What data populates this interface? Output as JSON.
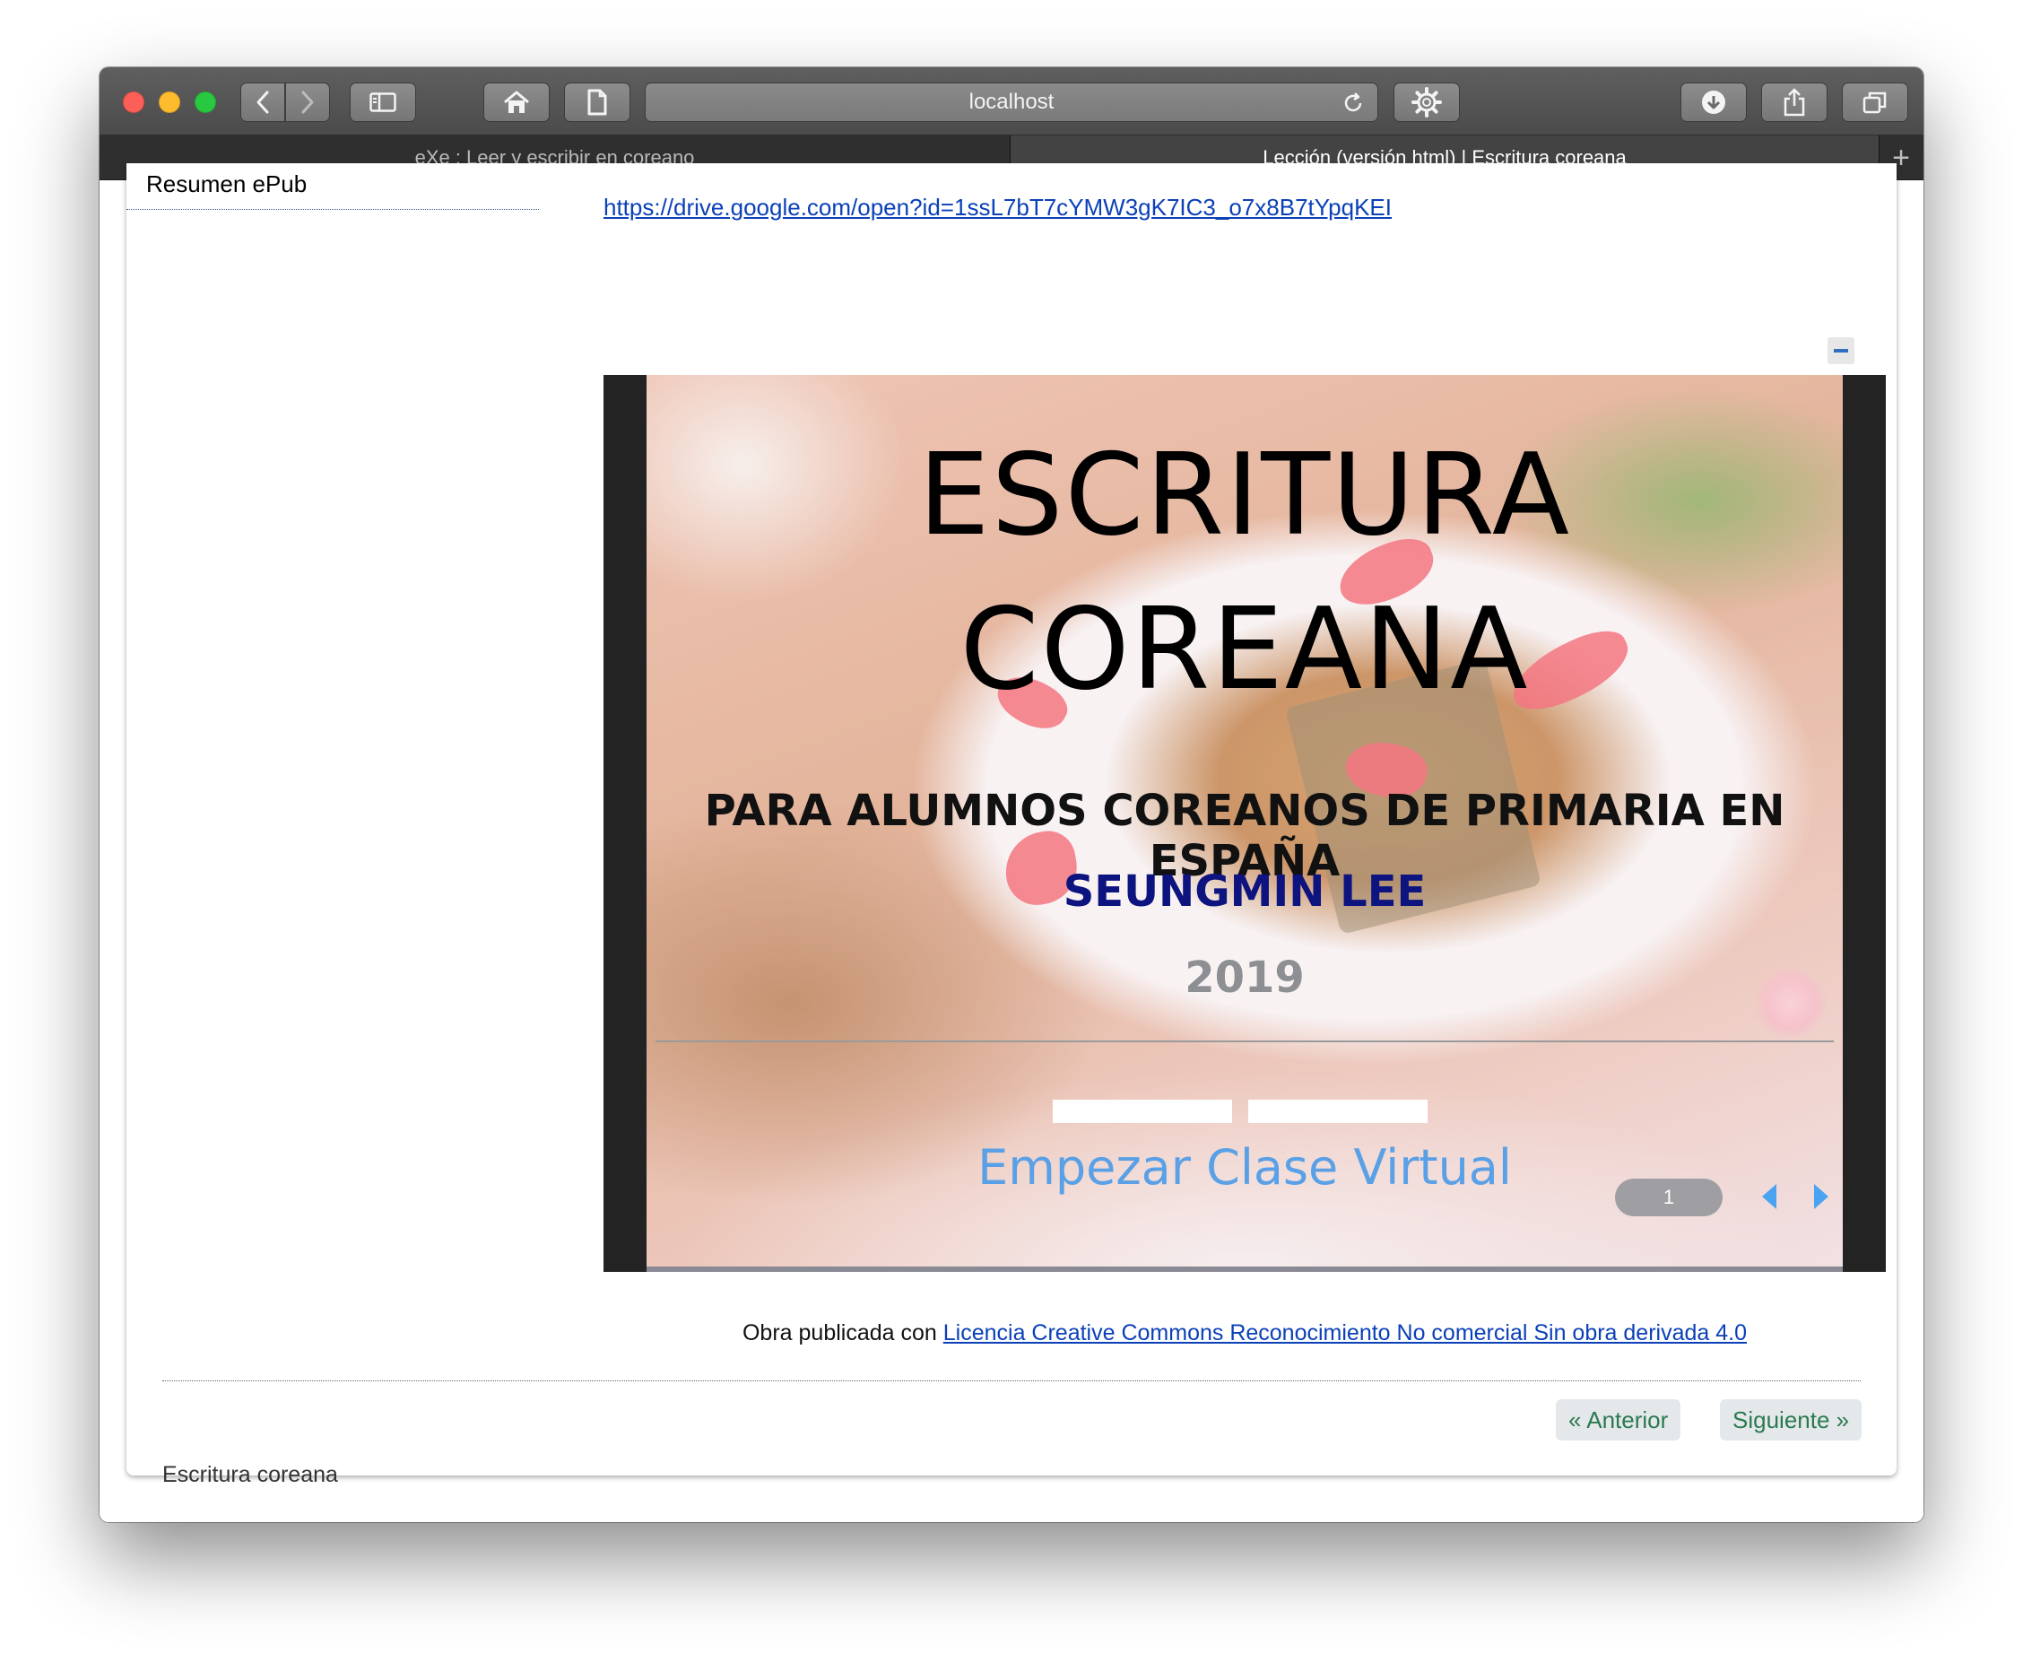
{
  "browser": {
    "address": "localhost",
    "tabs": [
      {
        "label": "eXe : Leer y escribir en coreano",
        "active": false
      },
      {
        "label": "Lección (versión html) | Escritura coreana",
        "active": true
      }
    ],
    "new_tab": "+"
  },
  "sidebar": {
    "items": [
      {
        "label": "Resumen ePub"
      }
    ]
  },
  "content": {
    "drive_link": "https://drive.google.com/open?id=1ssL7bT7cYMW3gK7IC3_o7x8B7tYpqKEI",
    "slide": {
      "title_line1": "ESCRITURA",
      "title_line2": "COREANA",
      "subtitle": "PARA ALUMNOS COREANOS DE PRIMARIA EN ESPAÑA",
      "author": "SEUNGMIN LEE",
      "year": "2019",
      "start_label": "Empezar Clase Virtual",
      "page_number": "1"
    },
    "license_prefix": "Obra publicada con",
    "license_link": "Licencia Creative Commons Reconocimiento No comercial Sin obra derivada 4.0"
  },
  "nav": {
    "prev": "« Anterior",
    "next": "Siguiente »"
  },
  "footer": {
    "title": "Escritura coreana"
  },
  "icons": [
    "back-icon",
    "forward-icon",
    "sidebar-icon",
    "home-icon",
    "page-icon",
    "reload-icon",
    "gear-icon",
    "download-icon",
    "share-icon",
    "tabs-icon"
  ],
  "colors": {
    "link": "#0b40b8",
    "nav_text": "#2a7a50",
    "author": "#0d137f",
    "start_label": "#5aa0e6"
  }
}
